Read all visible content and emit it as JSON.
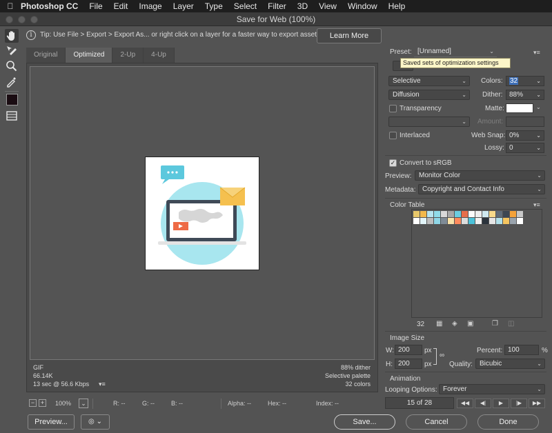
{
  "menubar": {
    "app": "Photoshop CC",
    "items": [
      "File",
      "Edit",
      "Image",
      "Layer",
      "Type",
      "Select",
      "Filter",
      "3D",
      "View",
      "Window",
      "Help"
    ]
  },
  "window": {
    "title": "Save for Web (100%)"
  },
  "tipbar": {
    "text": "Tip: Use File > Export > Export As...  or right click on a layer for a faster way to export assets",
    "learn_more": "Learn More"
  },
  "tabs": [
    {
      "label": "Original",
      "active": false
    },
    {
      "label": "Optimized",
      "active": true
    },
    {
      "label": "2-Up",
      "active": false
    },
    {
      "label": "4-Up",
      "active": false
    }
  ],
  "canvas_status": {
    "format": "GIF",
    "size": "66.14K",
    "time": "13 sec @ 56.6 Kbps",
    "dither": "88% dither",
    "palette": "Selective palette",
    "colors": "32 colors"
  },
  "infobar": {
    "zoom": "100%",
    "r": "R: --",
    "g": "G: --",
    "b": "B: --",
    "alpha": "Alpha: --",
    "hex": "Hex: --",
    "index": "Index: --"
  },
  "settings": {
    "preset_label": "Preset:",
    "preset_value": "[Unnamed]",
    "tooltip": "Saved sets of optimization settings",
    "reduction": "Selective",
    "colors_label": "Colors:",
    "colors_value": "32",
    "dither_algo": "Diffusion",
    "dither_label": "Dither:",
    "dither_value": "88%",
    "transparency_label": "Transparency",
    "matte_label": "Matte:",
    "amount_label": "Amount:",
    "interlaced_label": "Interlaced",
    "websnap_label": "Web Snap:",
    "websnap_value": "0%",
    "lossy_label": "Lossy:",
    "lossy_value": "0",
    "convert_label": "Convert to sRGB",
    "preview_label": "Preview:",
    "preview_value": "Monitor Color",
    "metadata_label": "Metadata:",
    "metadata_value": "Copyright and Contact Info",
    "color_table_label": "Color Table",
    "color_count": "32"
  },
  "image_size": {
    "label": "Image Size",
    "w_label": "W:",
    "w_value": "200",
    "h_label": "H:",
    "h_value": "200",
    "unit": "px",
    "percent_label": "Percent:",
    "percent_value": "100",
    "percent_unit": "%",
    "quality_label": "Quality:",
    "quality_value": "Bicubic"
  },
  "animation": {
    "label": "Animation",
    "looping_label": "Looping Options:",
    "looping_value": "Forever",
    "frame": "15 of 28"
  },
  "buttons": {
    "preview": "Preview...",
    "save": "Save...",
    "cancel": "Cancel",
    "done": "Done"
  },
  "colors": {
    "swatches": [
      "#e7c76a",
      "#f2b84b",
      "#b7e4ef",
      "#90dbe8",
      "#d9d9d9",
      "#a8a8a8",
      "#6ccde0",
      "#e66e4b",
      "#fbfbfb",
      "#eeeeee",
      "#cfe9f0",
      "#f7d98a",
      "#5f6b78",
      "#3c4652",
      "#f4a23a",
      "#c8c8c8",
      "#ffffff",
      "#e2f4f8",
      "#bdbdbd",
      "#8fd6e6",
      "#7f8b96",
      "#f9e3a8",
      "#ff8a5c",
      "#dcdcdc",
      "#4bc2d9",
      "#f0f0f0",
      "#2b333c",
      "#e5e5e5",
      "#b0dfe9",
      "#f5c560",
      "#9aa4ad",
      "#ffffff"
    ]
  }
}
